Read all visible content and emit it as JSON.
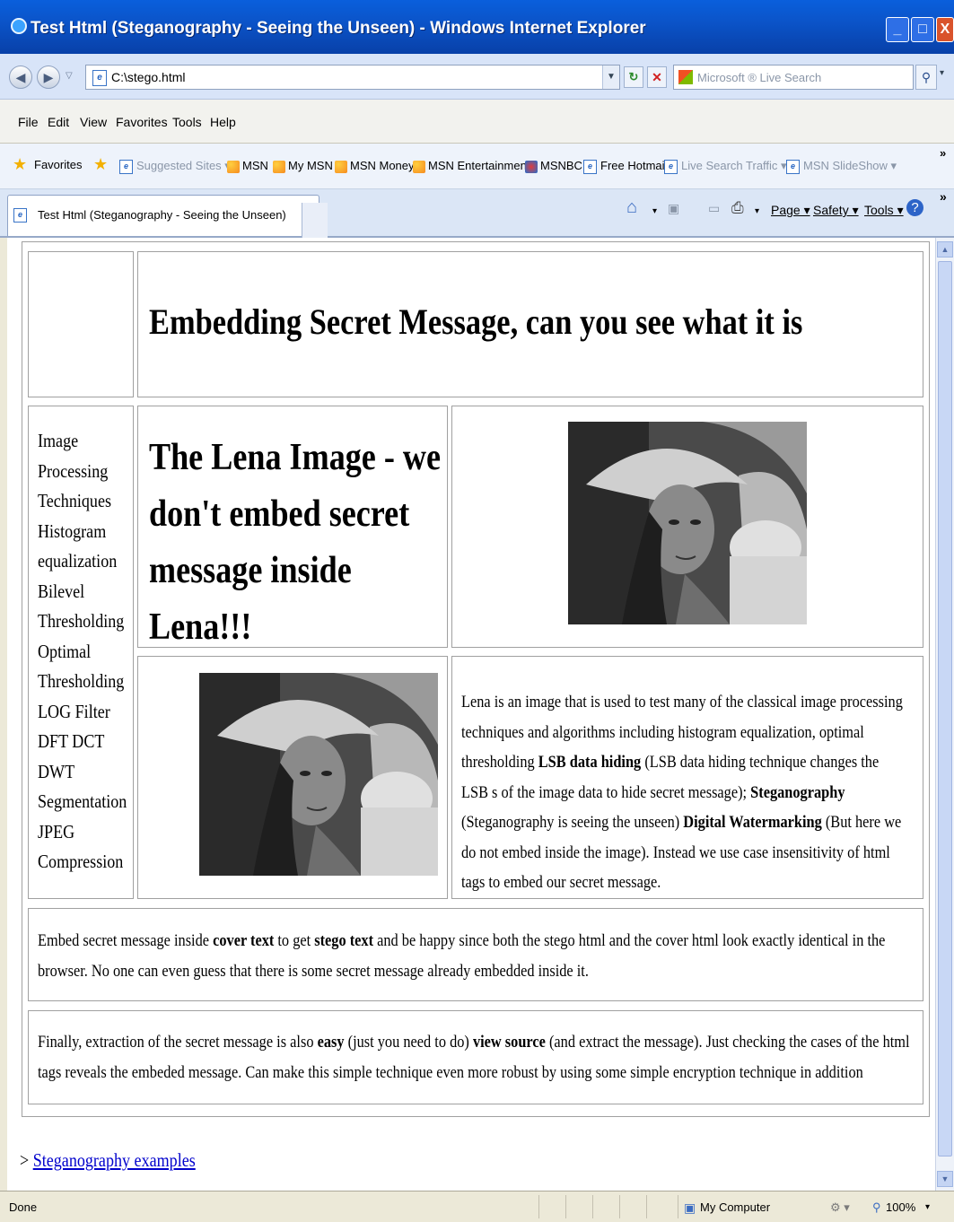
{
  "window": {
    "title": "Test Html (Steganography - Seeing the Unseen) - Windows Internet Explorer",
    "controls": [
      "_",
      "□",
      "X"
    ]
  },
  "address_bar": {
    "url": "C:\\stego.html",
    "search_placeholder": "Microsoft ® Live Search"
  },
  "menu": [
    "File",
    "Edit",
    "View",
    "Favorites",
    "Tools",
    "Help"
  ],
  "favorites_bar": {
    "favorites_label": "Favorites",
    "items": [
      "Suggested Sites ▾",
      "MSN",
      "My MSN",
      "MSN Money",
      "MSN Entertainment",
      "MSNBC",
      "Free Hotmail",
      "Live Search Traffic ▾",
      "MSN SlideShow ▾"
    ],
    "overflow": "»"
  },
  "tab": {
    "title": "Test Html (Steganography - Seeing the Unseen)"
  },
  "command_bar": {
    "page": "Page ▾",
    "safety": "Safety ▾",
    "tools": "Tools ▾",
    "overflow": "»"
  },
  "page": {
    "heading": "Embedding Secret Message, can you see what it is",
    "nav_items": [
      "Image",
      "Processing",
      "Techniques",
      "Histogram",
      "equalization",
      "Bilevel",
      "Thresholding",
      "Optimal",
      "Thresholding",
      "LOG Filter",
      "DFT DCT",
      "DWT",
      "Segmentation",
      "JPEG",
      "Compression"
    ],
    "lena_title": "The Lena Image - we don't embed secret message inside Lena!!!",
    "lena_paragraph": {
      "p1": "Lena is an image that is used to test many of the classical image processing techniques and algorithms including histogram equalization, optimal thresholding ",
      "b1": "LSB data hiding",
      "p2": " (LSB data hiding technique changes the LSB s of the image data to hide secret message); ",
      "b2": "Steganography",
      "p3": " (Steganography is seeing the unseen) ",
      "b3": "Digital Watermarking",
      "p4": " (But here we do not embed inside the image). Instead we use case insensitivity of html tags to embed our secret message."
    },
    "embed_paragraph": {
      "p1": "Embed secret message inside ",
      "b1": "cover text",
      "p2": " to get ",
      "b2": "stego text",
      "p3": " and be happy since both the stego html and the cover html look exactly identical in the browser. No one can even guess that there is some secret message already embedded inside it."
    },
    "final_paragraph": {
      "p1": "Finally, extraction of the secret message is also ",
      "b1": "easy",
      "p2": " (just you need to do) ",
      "b2": "view source",
      "p3": " (and extract the message). Just checking the cases of the html tags reveals the embeded message. Can make this simple technique even more robust by using some simple encryption technique in addition"
    },
    "link_prefix": "> ",
    "link_text": "Steganography examples"
  },
  "status_bar": {
    "status": "Done",
    "zone": "My Computer",
    "zoom": "100%"
  }
}
